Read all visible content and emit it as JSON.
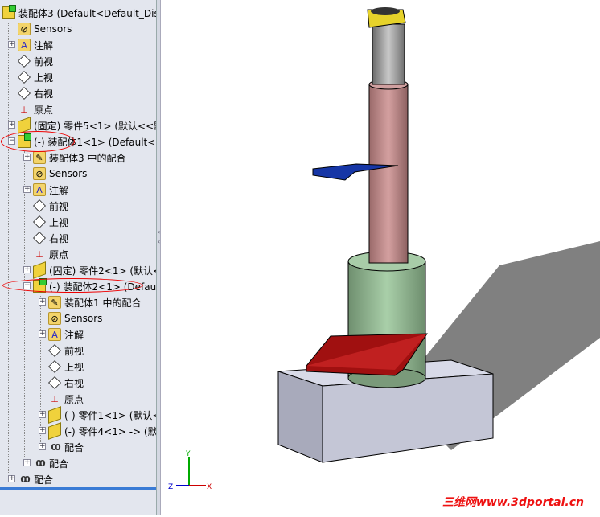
{
  "tree": [
    {
      "label": "装配体3  (Default<Default_Dis",
      "lvl": 0,
      "icon": "asm",
      "exp": ""
    },
    {
      "label": "Sensors",
      "lvl": 1,
      "icon": "sensor",
      "exp": ""
    },
    {
      "label": "注解",
      "lvl": 1,
      "icon": "annot",
      "exp": "+"
    },
    {
      "label": "前视",
      "lvl": 1,
      "icon": "plane",
      "exp": ""
    },
    {
      "label": "上视",
      "lvl": 1,
      "icon": "plane",
      "exp": ""
    },
    {
      "label": "右视",
      "lvl": 1,
      "icon": "plane",
      "exp": ""
    },
    {
      "label": "原点",
      "lvl": 1,
      "icon": "origin",
      "exp": ""
    },
    {
      "label": "(固定) 零件5<1> (默认<<默",
      "lvl": 1,
      "icon": "part",
      "exp": "+"
    },
    {
      "label": "(-) 装配体1<1> (Default<D",
      "lvl": 1,
      "icon": "asm",
      "exp": "−"
    },
    {
      "label": "装配体3 中的配合",
      "lvl": 2,
      "icon": "matefolder",
      "exp": "+"
    },
    {
      "label": "Sensors",
      "lvl": 2,
      "icon": "sensor",
      "exp": ""
    },
    {
      "label": "注解",
      "lvl": 2,
      "icon": "annot",
      "exp": "+"
    },
    {
      "label": "前视",
      "lvl": 2,
      "icon": "plane",
      "exp": ""
    },
    {
      "label": "上视",
      "lvl": 2,
      "icon": "plane",
      "exp": ""
    },
    {
      "label": "右视",
      "lvl": 2,
      "icon": "plane",
      "exp": ""
    },
    {
      "label": "原点",
      "lvl": 2,
      "icon": "origin",
      "exp": ""
    },
    {
      "label": "(固定) 零件2<1> (默认<",
      "lvl": 2,
      "icon": "part",
      "exp": "+"
    },
    {
      "label": "(-) 装配体2<1> (Default",
      "lvl": 2,
      "icon": "asm",
      "exp": "−"
    },
    {
      "label": "装配体1 中的配合",
      "lvl": 3,
      "icon": "matefolder",
      "exp": "+"
    },
    {
      "label": "Sensors",
      "lvl": 3,
      "icon": "sensor",
      "exp": ""
    },
    {
      "label": "注解",
      "lvl": 3,
      "icon": "annot",
      "exp": "+"
    },
    {
      "label": "前视",
      "lvl": 3,
      "icon": "plane",
      "exp": ""
    },
    {
      "label": "上视",
      "lvl": 3,
      "icon": "plane",
      "exp": ""
    },
    {
      "label": "右视",
      "lvl": 3,
      "icon": "plane",
      "exp": ""
    },
    {
      "label": "原点",
      "lvl": 3,
      "icon": "origin",
      "exp": ""
    },
    {
      "label": "(-) 零件1<1> (默认<",
      "lvl": 3,
      "icon": "part",
      "exp": "+"
    },
    {
      "label": "(-) 零件4<1> -> (默",
      "lvl": 3,
      "icon": "part",
      "exp": "+"
    },
    {
      "label": "配合",
      "lvl": 3,
      "icon": "mate",
      "exp": "+"
    },
    {
      "label": "配合",
      "lvl": 2,
      "icon": "mate",
      "exp": "+"
    },
    {
      "label": "配合",
      "lvl": 1,
      "icon": "mate",
      "exp": "+"
    }
  ],
  "triad": {
    "x": "X",
    "y": "Y",
    "z": "Z"
  },
  "watermark": "三维网www.3dportal.cn"
}
